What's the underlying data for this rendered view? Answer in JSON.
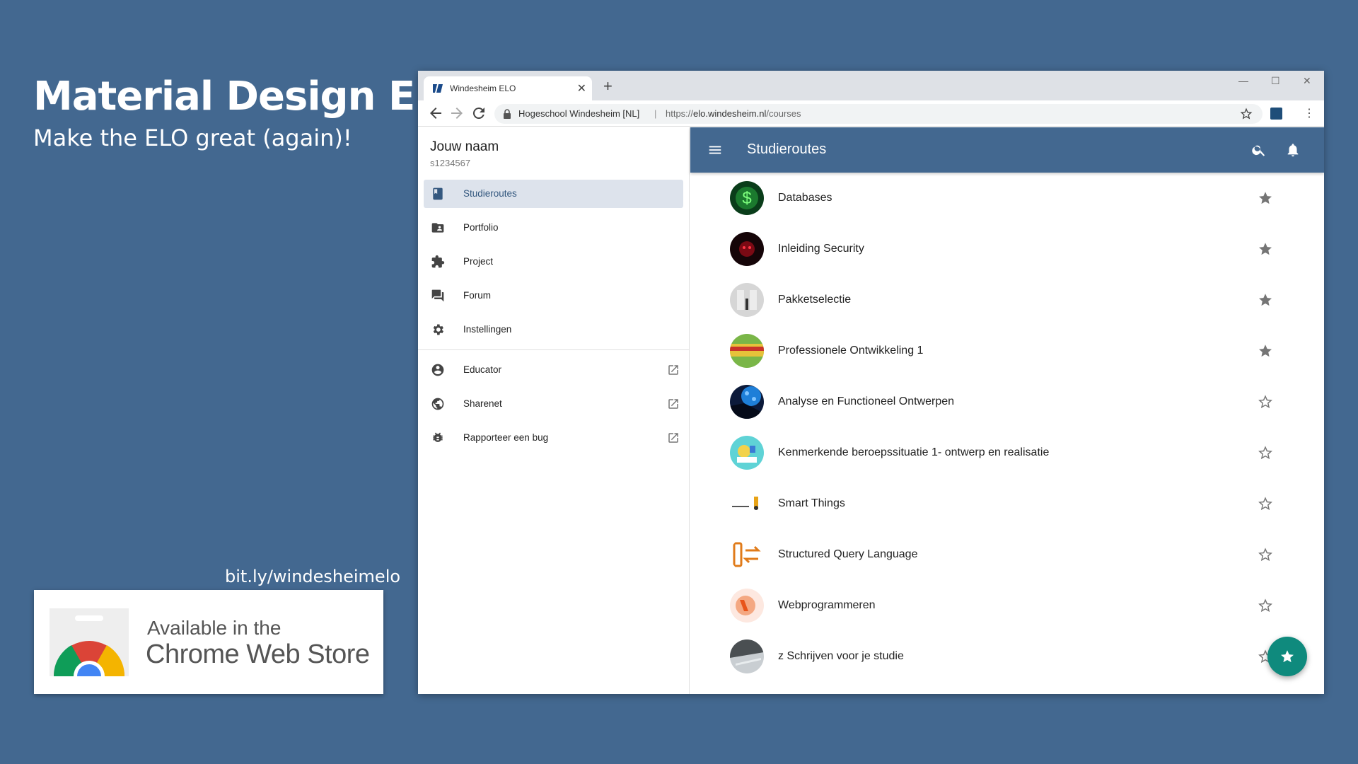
{
  "promo": {
    "title": "Material Design ELO",
    "subtitle": "Make the ELO great (again)!",
    "link": "bit.ly/windesheimelo",
    "store_line1": "Available in the",
    "store_line2": "Chrome Web Store"
  },
  "browser": {
    "tab_title": "Windesheim ELO",
    "site_identity": "Hogeschool Windesheim [NL]",
    "url_prefix": "https://",
    "url_host": "elo.windesheim.nl",
    "url_path": "/courses"
  },
  "drawer": {
    "user_name": "Jouw naam",
    "user_id": "s1234567",
    "items": [
      {
        "label": "Studieroutes",
        "icon": "book-icon",
        "active": true
      },
      {
        "label": "Portfolio",
        "icon": "portfolio-folder-icon"
      },
      {
        "label": "Project",
        "icon": "puzzle-icon"
      },
      {
        "label": "Forum",
        "icon": "forum-icon"
      },
      {
        "label": "Instellingen",
        "icon": "gear-icon"
      }
    ],
    "external": [
      {
        "label": "Educator",
        "icon": "account-circle-icon"
      },
      {
        "label": "Sharenet",
        "icon": "globe-icon"
      },
      {
        "label": "Rapporteer een bug",
        "icon": "bug-icon"
      }
    ]
  },
  "appbar": {
    "title": "Studieroutes"
  },
  "courses": [
    {
      "name": "Databases",
      "favorite": true
    },
    {
      "name": "Inleiding Security",
      "favorite": true
    },
    {
      "name": "Pakketselectie",
      "favorite": true
    },
    {
      "name": "Professionele Ontwikkeling 1",
      "favorite": true
    },
    {
      "name": "Analyse en Functioneel Ontwerpen",
      "favorite": false
    },
    {
      "name": "Kenmerkende beroepssituatie 1- ontwerp en realisatie",
      "favorite": false
    },
    {
      "name": "Smart Things",
      "favorite": false
    },
    {
      "name": "Structured Query Language",
      "favorite": false
    },
    {
      "name": "Webprogrammeren",
      "favorite": false
    },
    {
      "name": "z Schrijven voor je studie",
      "favorite": false
    }
  ],
  "colors": {
    "accent": "#436890",
    "fab": "#0f8a7d",
    "active_bg": "#dde3ec"
  }
}
